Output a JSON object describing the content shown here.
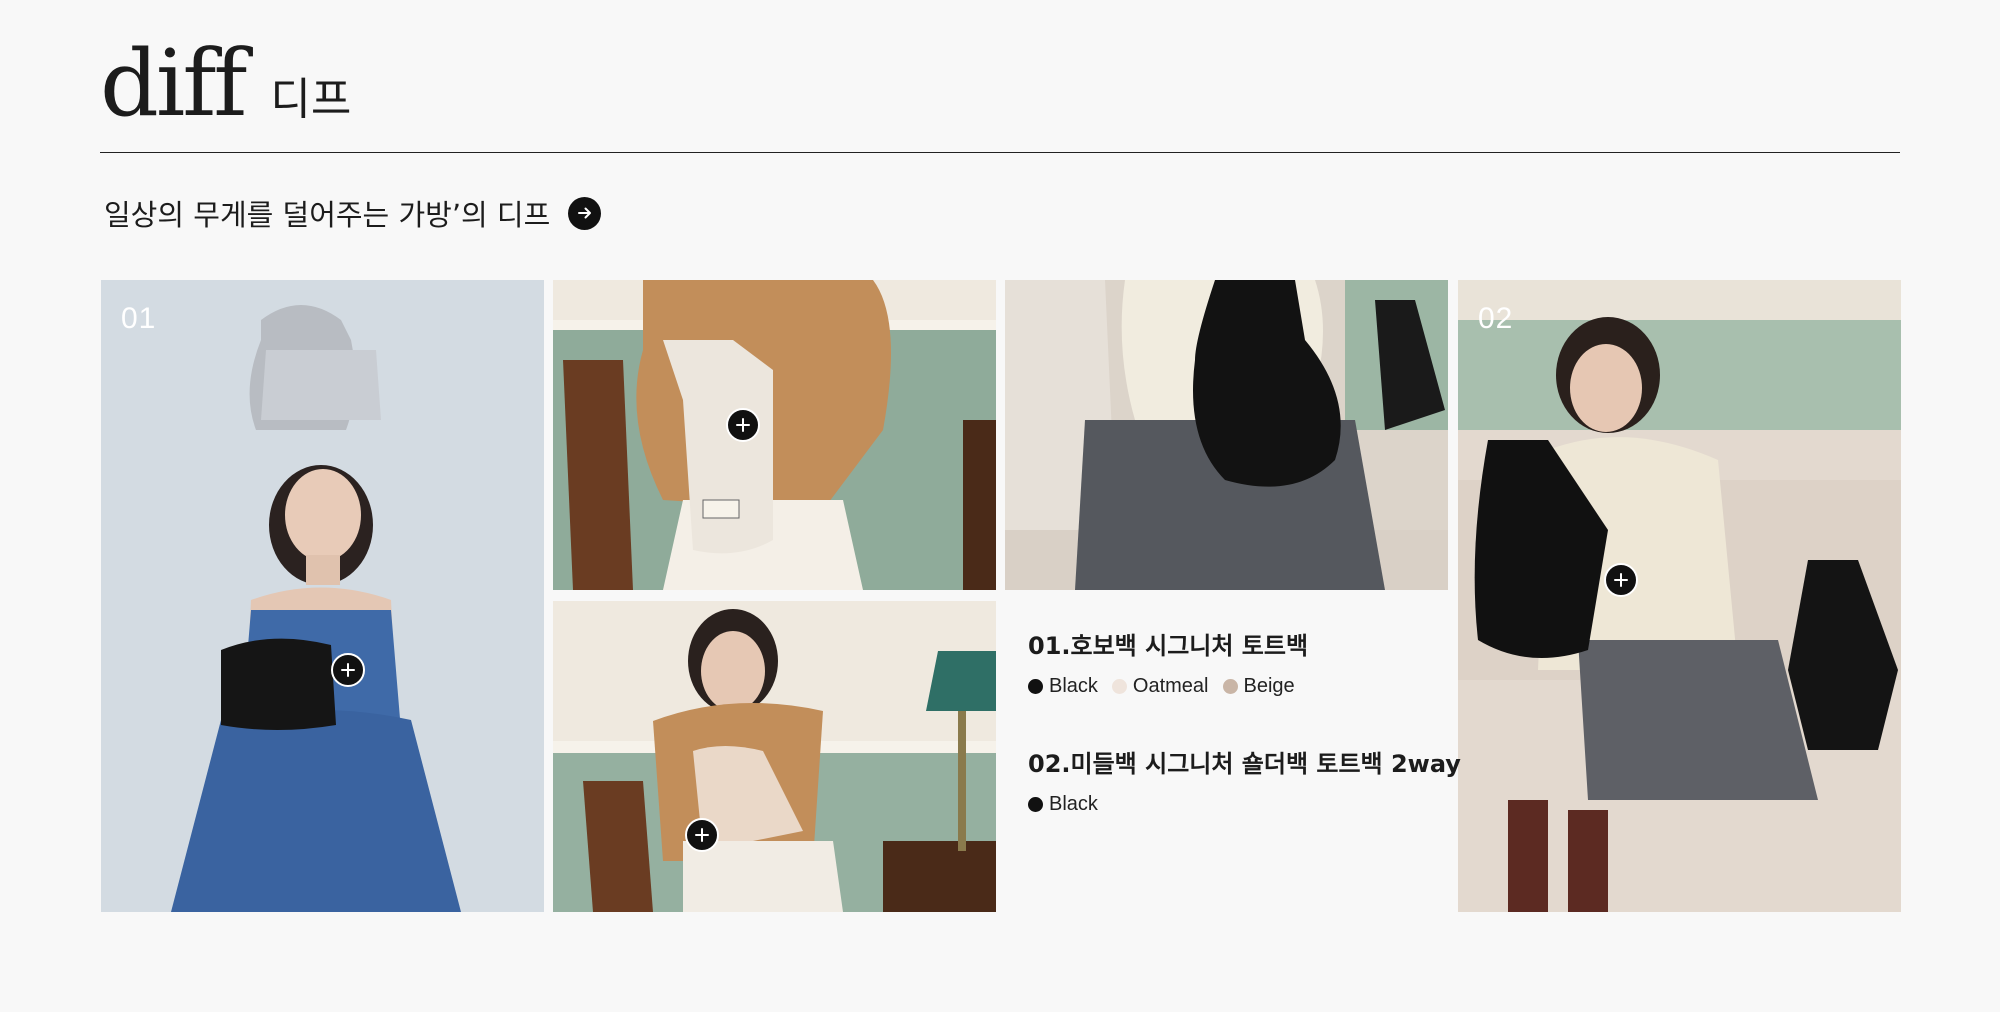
{
  "brand": {
    "logo": "diff",
    "korean": "디프"
  },
  "tagline": {
    "text": "일상의 무게를 덜어주는 가방’의 디프"
  },
  "photos": {
    "first_number": "01",
    "second_number": "02"
  },
  "products": [
    {
      "title": "01.호보백 시그니처 토트백",
      "colors": [
        {
          "name": "Black",
          "hex": "#111111"
        },
        {
          "name": "Oatmeal",
          "hex": "#efe4dc"
        },
        {
          "name": "Beige",
          "hex": "#c9b5a6"
        }
      ]
    },
    {
      "title": "02.미들백 시그니처 숄더백 토트백 2way",
      "colors": [
        {
          "name": "Black",
          "hex": "#111111"
        }
      ]
    }
  ],
  "icons": {
    "arrow": "arrow-right-icon",
    "hotspot": "plus-icon"
  },
  "theme": {
    "accent": "#111111",
    "background": "#f8f8f8"
  }
}
